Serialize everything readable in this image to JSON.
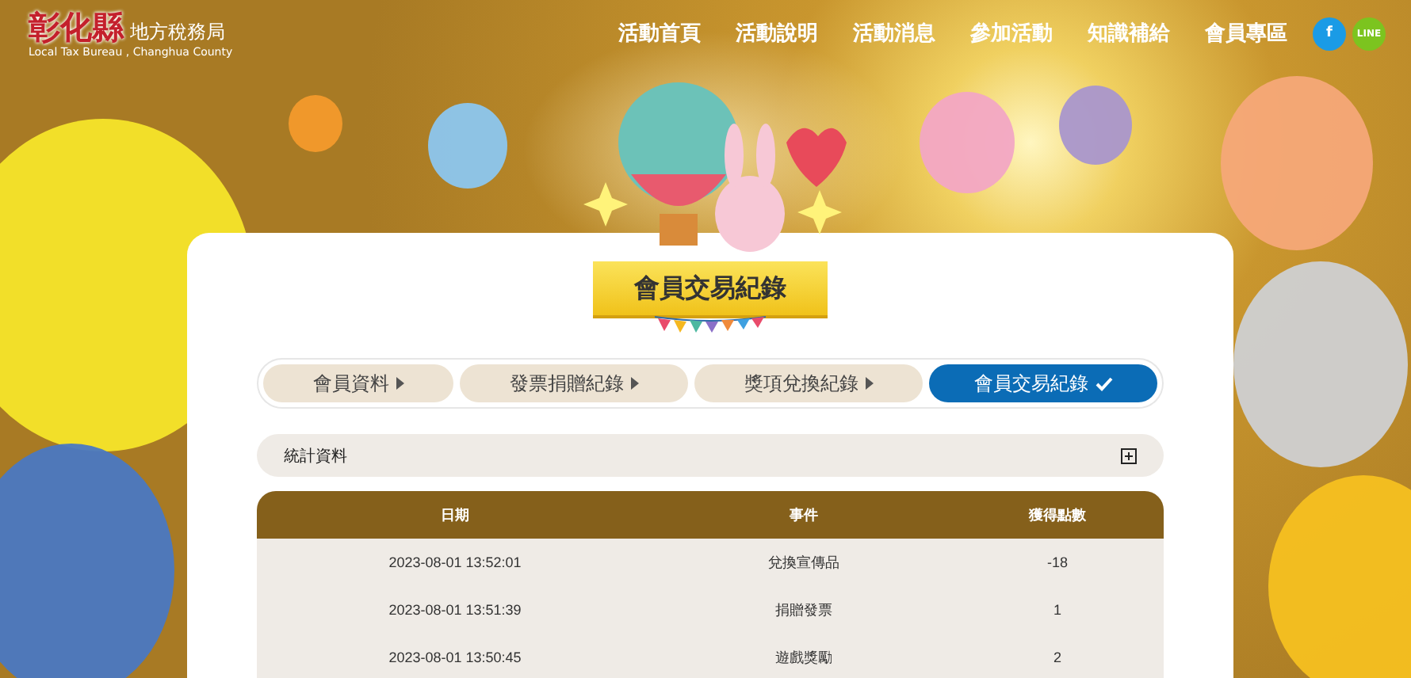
{
  "logo": {
    "title": "彰化縣",
    "subtitle": "地方稅務局",
    "english": "Local Tax Bureau , Changhua County"
  },
  "nav": [
    "活動首頁",
    "活動說明",
    "活動消息",
    "參加活動",
    "知識補給",
    "會員專區"
  ],
  "social": [
    {
      "kind": "facebook",
      "label": "f",
      "color": "#1a9be6"
    },
    {
      "kind": "line",
      "label": "LINE",
      "color": "#7cc41f"
    }
  ],
  "page_title": "會員交易紀錄",
  "tabs": [
    {
      "label": "會員資料",
      "selected": false
    },
    {
      "label": "發票捐贈紀錄",
      "selected": false
    },
    {
      "label": "獎項兌換紀錄",
      "selected": false
    },
    {
      "label": "會員交易紀錄",
      "selected": true
    }
  ],
  "stats": {
    "label": "統計資料",
    "expanded": false
  },
  "table": {
    "columns": [
      "日期",
      "事件",
      "獲得點數"
    ],
    "rows": [
      [
        "2023-08-01 13:52:01",
        "兌換宣傳品",
        "-18"
      ],
      [
        "2023-08-01 13:51:39",
        "捐贈發票",
        "1"
      ],
      [
        "2023-08-01 13:50:45",
        "遊戲獎勵",
        "2"
      ]
    ]
  }
}
